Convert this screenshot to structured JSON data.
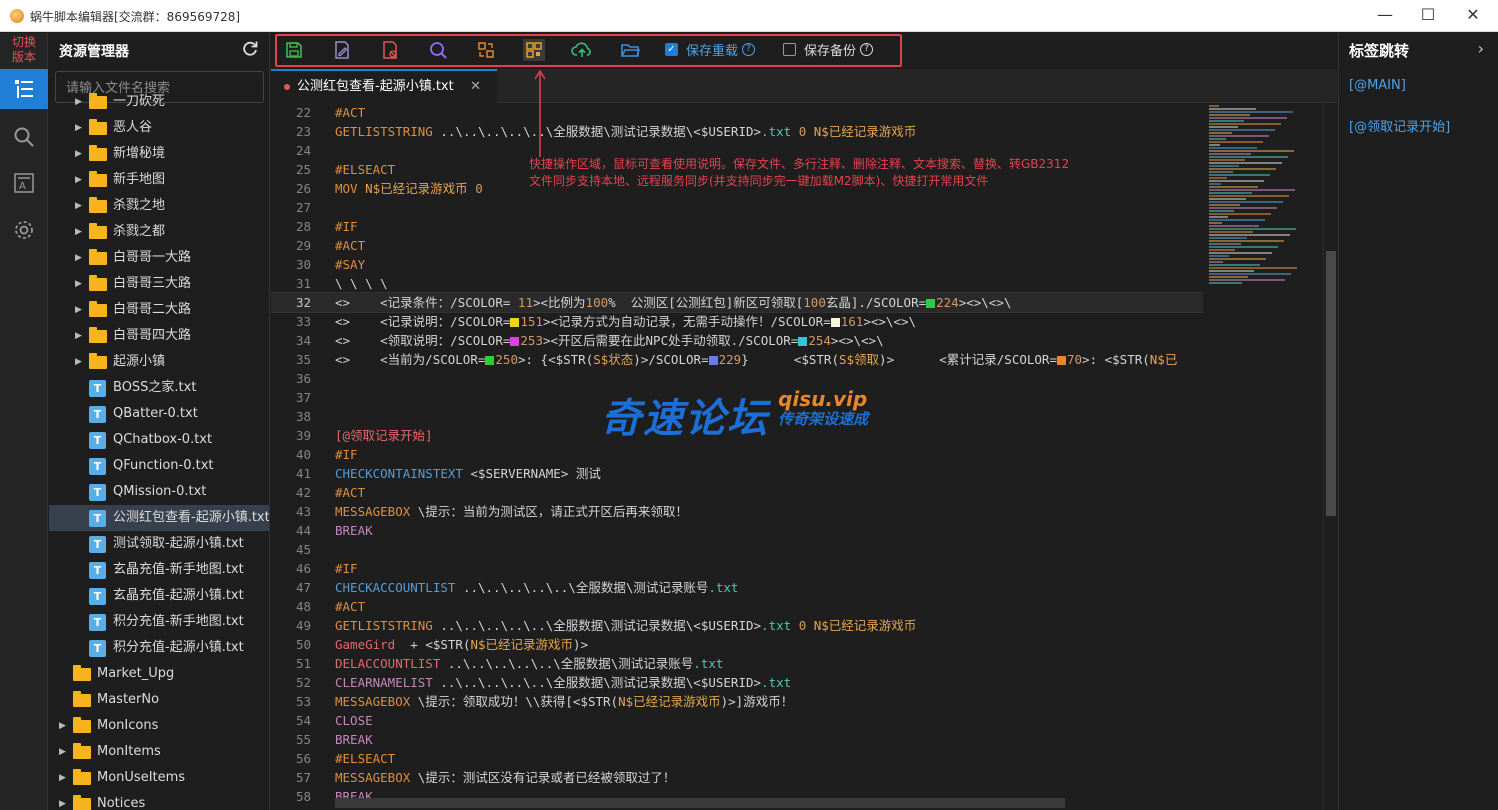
{
  "window": {
    "title": "蜗牛脚本编辑器[交流群：869569728]",
    "minimize": "—",
    "maximize": "☐",
    "close": "✕"
  },
  "activity_bar": {
    "switch_version_line1": "切换",
    "switch_version_line2": "版本",
    "items": [
      "explorer-icon",
      "search-icon",
      "font-icon",
      "gear-icon"
    ]
  },
  "explorer": {
    "title": "资源管理器",
    "search_placeholder": "请输入文件名搜索",
    "tree": [
      {
        "label": "一刀砍死",
        "type": "folder",
        "level": 1,
        "expandable": true
      },
      {
        "label": "恶人谷",
        "type": "folder",
        "level": 1,
        "expandable": true
      },
      {
        "label": "新增秘境",
        "type": "folder",
        "level": 1,
        "expandable": true
      },
      {
        "label": "新手地图",
        "type": "folder",
        "level": 1,
        "expandable": true
      },
      {
        "label": "杀戮之地",
        "type": "folder",
        "level": 1,
        "expandable": true
      },
      {
        "label": "杀戮之都",
        "type": "folder",
        "level": 1,
        "expandable": true
      },
      {
        "label": "白哥哥一大路",
        "type": "folder",
        "level": 1,
        "expandable": true
      },
      {
        "label": "白哥哥三大路",
        "type": "folder",
        "level": 1,
        "expandable": true
      },
      {
        "label": "白哥哥二大路",
        "type": "folder",
        "level": 1,
        "expandable": true
      },
      {
        "label": "白哥哥四大路",
        "type": "folder",
        "level": 1,
        "expandable": true
      },
      {
        "label": "起源小镇",
        "type": "folder",
        "level": 1,
        "expandable": true
      },
      {
        "label": "BOSS之家.txt",
        "type": "file",
        "level": 1
      },
      {
        "label": "QBatter-0.txt",
        "type": "file",
        "level": 1
      },
      {
        "label": "QChatbox-0.txt",
        "type": "file",
        "level": 1
      },
      {
        "label": "QFunction-0.txt",
        "type": "file",
        "level": 1
      },
      {
        "label": "QMission-0.txt",
        "type": "file",
        "level": 1
      },
      {
        "label": "公测红包查看-起源小镇.txt",
        "type": "file",
        "level": 1,
        "selected": true
      },
      {
        "label": "测试领取-起源小镇.txt",
        "type": "file",
        "level": 1
      },
      {
        "label": "玄晶充值-新手地图.txt",
        "type": "file",
        "level": 1
      },
      {
        "label": "玄晶充值-起源小镇.txt",
        "type": "file",
        "level": 1
      },
      {
        "label": "积分充值-新手地图.txt",
        "type": "file",
        "level": 1
      },
      {
        "label": "积分充值-起源小镇.txt",
        "type": "file",
        "level": 1
      },
      {
        "label": "Market_Upg",
        "type": "folder",
        "level": 0,
        "expandable": false
      },
      {
        "label": "MasterNo",
        "type": "folder",
        "level": 0,
        "expandable": false
      },
      {
        "label": "MonIcons",
        "type": "folder",
        "level": 0,
        "expandable": true
      },
      {
        "label": "MonItems",
        "type": "folder",
        "level": 0,
        "expandable": true
      },
      {
        "label": "MonUseItems",
        "type": "folder",
        "level": 0,
        "expandable": true
      },
      {
        "label": "Notices",
        "type": "folder",
        "level": 0,
        "expandable": true
      }
    ]
  },
  "toolbar": {
    "buttons": [
      "save-icon",
      "edit-icon",
      "delete-comment-icon",
      "text-search-icon",
      "replace-icon",
      "convert-gb2312-icon",
      "cloud-sync-icon",
      "open-folder-icon"
    ],
    "save_reload_label": "保存重载",
    "save_reload_checked": true,
    "save_backup_label": "保存备份",
    "save_backup_checked": false
  },
  "tab": {
    "label": "公测红包查看-起源小镇.txt",
    "close": "✕"
  },
  "annotation": {
    "line1": "快捷操作区域，鼠标可查看使用说明。保存文件、多行注释、删除注释、文本搜索、替换、转GB2312",
    "line2": "文件同步支持本地、远程服务同步(并支持同步完一键加载M2脚本)、快捷打开常用文件"
  },
  "watermark": {
    "main": "奇速论坛",
    "url": "qisu.vip",
    "sub": "传奇架设速成"
  },
  "code": {
    "current_line": 32,
    "lines": [
      {
        "n": 22,
        "segs": [
          [
            "kw",
            "#ACT"
          ]
        ]
      },
      {
        "n": 23,
        "segs": [
          [
            "kw",
            "GETLISTSTRING"
          ],
          [
            "",
            " ..\\..\\..\\..\\..\\全服数据\\测试记录数据\\<$USERID>"
          ],
          [
            "tx",
            ".txt"
          ],
          [
            "",
            " "
          ],
          [
            "num",
            "0"
          ],
          [
            "",
            " "
          ],
          [
            "str",
            "N$已经记录游戏币"
          ]
        ]
      },
      {
        "n": 24,
        "segs": []
      },
      {
        "n": 25,
        "segs": [
          [
            "kw",
            "#ELSEACT"
          ]
        ]
      },
      {
        "n": 26,
        "segs": [
          [
            "kw",
            "MOV"
          ],
          [
            "",
            " "
          ],
          [
            "str",
            "N$已经记录游戏币"
          ],
          [
            "",
            " "
          ],
          [
            "num",
            "0"
          ]
        ]
      },
      {
        "n": 27,
        "segs": []
      },
      {
        "n": 28,
        "segs": [
          [
            "kw",
            "#IF"
          ]
        ]
      },
      {
        "n": 29,
        "segs": [
          [
            "kw",
            "#ACT"
          ]
        ]
      },
      {
        "n": 30,
        "segs": [
          [
            "kw",
            "#SAY"
          ]
        ]
      },
      {
        "n": 31,
        "segs": [
          [
            "",
            "\\ \\ \\ \\"
          ]
        ]
      },
      {
        "n": 32,
        "segs": [
          [
            "",
            "<>    <记录条件：/SCOLOR= "
          ],
          [
            "num",
            "11"
          ],
          [
            "",
            "><比例为"
          ],
          [
            "num",
            "100"
          ],
          [
            "",
            "%  公测区[公测红包]新区可领取["
          ],
          [
            "num",
            "100"
          ],
          [
            "",
            "玄晶]./SCOLOR="
          ],
          [
            "sw",
            "#2ecc40"
          ],
          [
            "num",
            "224"
          ],
          [
            "",
            "><>\\<>\\"
          ]
        ]
      },
      {
        "n": 33,
        "segs": [
          [
            "",
            "<>    <记录说明：/SCOLOR="
          ],
          [
            "sw",
            "#f1d21b"
          ],
          [
            "num",
            "151"
          ],
          [
            "",
            "><记录方式为自动记录，无需手动操作！/SCOLOR="
          ],
          [
            "sw",
            "#f8f4d8"
          ],
          [
            "num",
            "161"
          ],
          [
            "",
            "><>\\<>\\"
          ]
        ]
      },
      {
        "n": 34,
        "segs": [
          [
            "",
            "<>    <领取说明：/SCOLOR="
          ],
          [
            "sw",
            "#e23de2"
          ],
          [
            "num",
            "253"
          ],
          [
            "",
            "><开区后需要在此NPC处手动领取./SCOLOR="
          ],
          [
            "sw",
            "#33c7d6"
          ],
          [
            "num",
            "254"
          ],
          [
            "",
            "><>\\<>\\"
          ]
        ]
      },
      {
        "n": 35,
        "segs": [
          [
            "",
            "<>    <当前为/SCOLOR="
          ],
          [
            "sw",
            "#2ecc40"
          ],
          [
            "num",
            "250"
          ],
          [
            "",
            ">: {<$STR("
          ],
          [
            "str",
            "S$状态"
          ],
          [
            "",
            ")>/SCOLOR="
          ],
          [
            "sw",
            "#6a7fdb"
          ],
          [
            "num",
            "229"
          ],
          [
            "",
            "}      <$STR("
          ],
          [
            "str",
            "S$领取"
          ],
          [
            "",
            ")>      <累计记录/SCOLOR="
          ],
          [
            "sw",
            "#e8862a"
          ],
          [
            "num",
            "70"
          ],
          [
            "",
            ">: <$STR("
          ],
          [
            "str",
            "N$已"
          ]
        ]
      },
      {
        "n": 36,
        "segs": []
      },
      {
        "n": 37,
        "segs": []
      },
      {
        "n": 38,
        "segs": []
      },
      {
        "n": 39,
        "segs": [
          [
            "red",
            "[@领取记录开始]"
          ]
        ]
      },
      {
        "n": 40,
        "segs": [
          [
            "kw",
            "#IF"
          ]
        ]
      },
      {
        "n": 41,
        "segs": [
          [
            "cmd",
            "CHECKCONTAINSTEXT"
          ],
          [
            "",
            " <$SERVERNAME> 测试"
          ]
        ]
      },
      {
        "n": 42,
        "segs": [
          [
            "kw",
            "#ACT"
          ]
        ]
      },
      {
        "n": 43,
        "segs": [
          [
            "kw",
            "MESSAGEBOX"
          ],
          [
            "",
            " \\提示：当前为测试区，请正式开区后再来领取！"
          ]
        ]
      },
      {
        "n": 44,
        "segs": [
          [
            "pur",
            "BREAK"
          ]
        ]
      },
      {
        "n": 45,
        "segs": []
      },
      {
        "n": 46,
        "segs": [
          [
            "kw",
            "#IF"
          ]
        ]
      },
      {
        "n": 47,
        "segs": [
          [
            "cmd",
            "CHECKACCOUNTLIST"
          ],
          [
            "",
            " ..\\..\\..\\..\\..\\全服数据\\测试记录账号"
          ],
          [
            "tx",
            ".txt"
          ]
        ]
      },
      {
        "n": 48,
        "segs": [
          [
            "kw",
            "#ACT"
          ]
        ]
      },
      {
        "n": 49,
        "segs": [
          [
            "kw",
            "GETLISTSTRING"
          ],
          [
            "",
            " ..\\..\\..\\..\\..\\全服数据\\测试记录数据\\<$USERID>"
          ],
          [
            "tx",
            ".txt"
          ],
          [
            "",
            " "
          ],
          [
            "num",
            "0"
          ],
          [
            "",
            " "
          ],
          [
            "str",
            "N$已经记录游戏币"
          ]
        ]
      },
      {
        "n": 50,
        "segs": [
          [
            "red",
            "GameGird"
          ],
          [
            "",
            "  + <$STR("
          ],
          [
            "str",
            "N$已经记录游戏币"
          ],
          [
            "",
            ")>"
          ]
        ]
      },
      {
        "n": 51,
        "segs": [
          [
            "red",
            "DELACCOUNTLIST"
          ],
          [
            "",
            " ..\\..\\..\\..\\..\\全服数据\\测试记录账号"
          ],
          [
            "tx",
            ".txt"
          ]
        ]
      },
      {
        "n": 52,
        "segs": [
          [
            "pur",
            "CLEARNAMELIST"
          ],
          [
            "",
            " ..\\..\\..\\..\\..\\全服数据\\测试记录数据\\<$USERID>"
          ],
          [
            "tx",
            ".txt"
          ]
        ]
      },
      {
        "n": 53,
        "segs": [
          [
            "kw",
            "MESSAGEBOX"
          ],
          [
            "",
            " \\提示：领取成功！\\\\获得[<$STR("
          ],
          [
            "str",
            "N$已经记录游戏币"
          ],
          [
            "",
            ")>]游戏币！"
          ]
        ]
      },
      {
        "n": 54,
        "segs": [
          [
            "pur",
            "CLOSE"
          ]
        ]
      },
      {
        "n": 55,
        "segs": [
          [
            "pur",
            "BREAK"
          ]
        ]
      },
      {
        "n": 56,
        "segs": [
          [
            "kw",
            "#ELSEACT"
          ]
        ]
      },
      {
        "n": 57,
        "segs": [
          [
            "kw",
            "MESSAGEBOX"
          ],
          [
            "",
            " \\提示：测试区没有记录或者已经被领取过了！"
          ]
        ]
      },
      {
        "n": 58,
        "segs": [
          [
            "pur",
            "BREAK"
          ]
        ]
      }
    ]
  },
  "right_panel": {
    "title": "标签跳转",
    "items": [
      "[@MAIN]",
      "[@领取记录开始]"
    ]
  }
}
